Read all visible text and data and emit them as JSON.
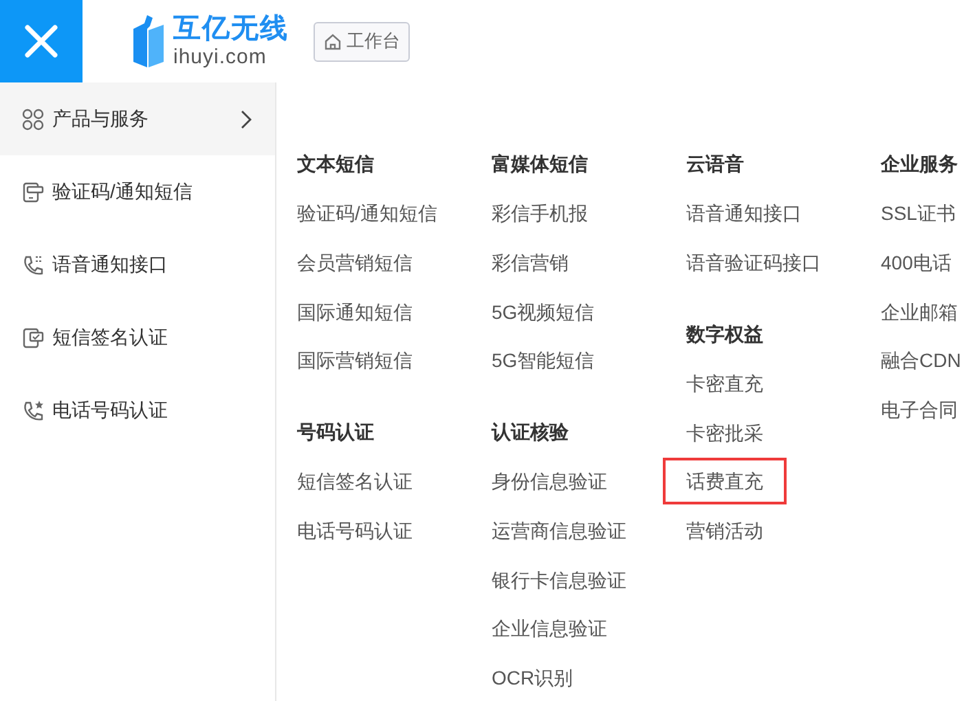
{
  "header": {
    "brand_name": "互亿无线",
    "brand_domain": "ihuyi.com",
    "workbench_button": "工作台"
  },
  "sidebar": {
    "items": [
      {
        "label": "产品与服务",
        "selected": true
      },
      {
        "label": "验证码/通知短信",
        "selected": false
      },
      {
        "label": "语音通知接口",
        "selected": false
      },
      {
        "label": "短信签名认证",
        "selected": false
      },
      {
        "label": "电话号码认证",
        "selected": false
      }
    ]
  },
  "menu": {
    "columns": [
      {
        "groups": [
          {
            "title": "文本短信",
            "items": [
              {
                "label": "验证码/通知短信",
                "highlighted": false
              },
              {
                "label": "会员营销短信",
                "highlighted": false
              },
              {
                "label": "国际通知短信",
                "highlighted": false
              },
              {
                "label": "国际营销短信",
                "highlighted": false
              }
            ]
          },
          {
            "title": "号码认证",
            "items": [
              {
                "label": "短信签名认证",
                "highlighted": false
              },
              {
                "label": "电话号码认证",
                "highlighted": false
              }
            ]
          }
        ]
      },
      {
        "groups": [
          {
            "title": "富媒体短信",
            "items": [
              {
                "label": "彩信手机报",
                "highlighted": false
              },
              {
                "label": "彩信营销",
                "highlighted": false
              },
              {
                "label": "5G视频短信",
                "highlighted": false
              },
              {
                "label": "5G智能短信",
                "highlighted": false
              }
            ]
          },
          {
            "title": "认证核验",
            "items": [
              {
                "label": "身份信息验证",
                "highlighted": false
              },
              {
                "label": "运营商信息验证",
                "highlighted": false
              },
              {
                "label": "银行卡信息验证",
                "highlighted": false
              },
              {
                "label": "企业信息验证",
                "highlighted": false
              },
              {
                "label": "OCR识别",
                "highlighted": false
              }
            ]
          }
        ]
      },
      {
        "groups": [
          {
            "title": "云语音",
            "items": [
              {
                "label": "语音通知接口",
                "highlighted": false
              },
              {
                "label": "语音验证码接口",
                "highlighted": false
              }
            ]
          },
          {
            "title": "数字权益",
            "items": [
              {
                "label": "卡密直充",
                "highlighted": false
              },
              {
                "label": "卡密批采",
                "highlighted": false
              },
              {
                "label": "话费直充",
                "highlighted": true
              },
              {
                "label": "营销活动",
                "highlighted": false
              }
            ]
          }
        ]
      },
      {
        "groups": [
          {
            "title": "企业服务",
            "items": [
              {
                "label": "SSL证书",
                "highlighted": false
              },
              {
                "label": "400电话",
                "highlighted": false
              },
              {
                "label": "企业邮箱",
                "highlighted": false
              },
              {
                "label": "融合CDN",
                "highlighted": false
              },
              {
                "label": "电子合同",
                "highlighted": false
              }
            ]
          }
        ]
      }
    ]
  }
}
